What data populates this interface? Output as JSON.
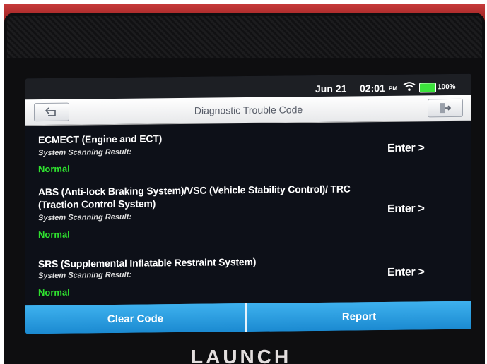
{
  "status_bar": {
    "date": "Jun 21",
    "time": "02:01",
    "period": "PM",
    "battery": "100%"
  },
  "header": {
    "title": "Diagnostic Trouble Code"
  },
  "systems": [
    {
      "name": "ECMECT (Engine and ECT)",
      "result_label": "System Scanning Result:",
      "status": "Normal",
      "enter_label": "Enter >"
    },
    {
      "name": "ABS (Anti-lock Braking System)/VSC (Vehicle Stability Control)/ TRC (Traction Control System)",
      "result_label": "System Scanning Result:",
      "status": "Normal",
      "enter_label": "Enter >"
    },
    {
      "name": "SRS (Supplemental Inflatable Restraint System)",
      "result_label": "System Scanning Result:",
      "status": "Normal",
      "enter_label": "Enter >"
    }
  ],
  "footer": {
    "clear_code_label": "Clear Code",
    "report_label": "Report"
  },
  "device": {
    "brand": "LAUNCH"
  },
  "colors": {
    "status_normal": "#2fe12f",
    "footer_blue": "#2a9ddf",
    "screen_bg": "#0d1018"
  },
  "icons": {
    "back": "back-arrow-icon",
    "exit": "exit-icon",
    "wifi": "wifi-icon",
    "battery": "battery-icon"
  }
}
